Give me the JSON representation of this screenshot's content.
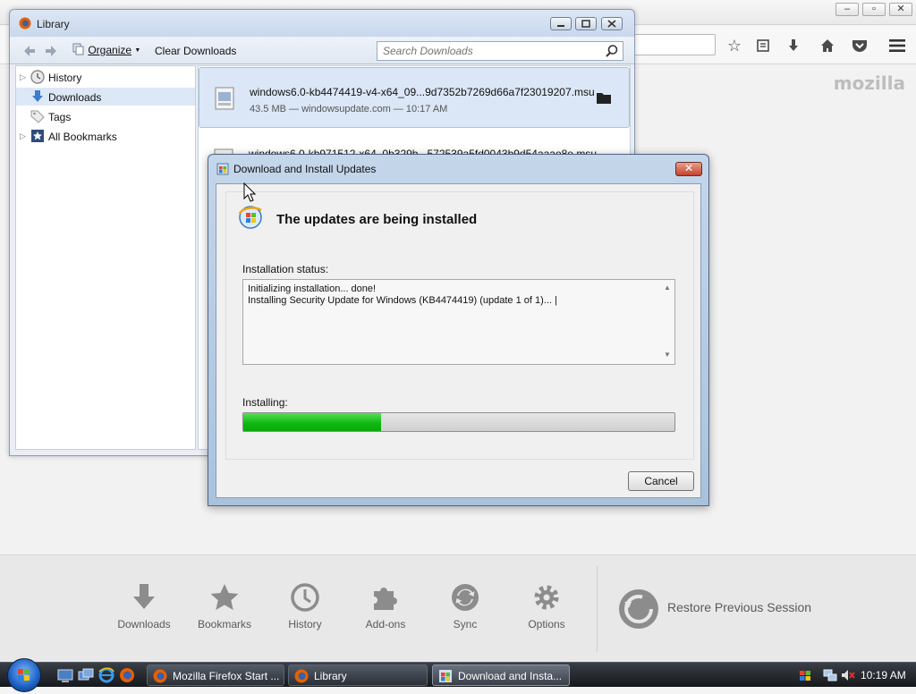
{
  "firefox": {
    "brand": "mozilla",
    "launcher": [
      {
        "label": "Downloads",
        "icon": "download-icon"
      },
      {
        "label": "Bookmarks",
        "icon": "star-icon"
      },
      {
        "label": "History",
        "icon": "clock-icon"
      },
      {
        "label": "Add-ons",
        "icon": "puzzle-icon"
      },
      {
        "label": "Sync",
        "icon": "sync-icon"
      },
      {
        "label": "Options",
        "icon": "gear-icon"
      }
    ],
    "restore_label": "Restore Previous Session"
  },
  "library": {
    "title": "Library",
    "toolbar": {
      "organize_label": "Organize",
      "clear_label": "Clear Downloads",
      "search_placeholder": "Search Downloads"
    },
    "sidebar": [
      {
        "label": "History",
        "icon": "clock-icon",
        "expandable": true
      },
      {
        "label": "Downloads",
        "icon": "download-icon",
        "selected": true
      },
      {
        "label": "Tags",
        "icon": "tag-icon"
      },
      {
        "label": "All Bookmarks",
        "icon": "bookmarks-icon",
        "expandable": true
      }
    ],
    "downloads": [
      {
        "name": "windows6.0-kb4474419-v4-x64_09...9d7352b7269d66a7f23019207.msu",
        "meta": "43.5 MB — windowsupdate.com — 10:17 AM"
      },
      {
        "name": "windows6.0-kb971512-x64_0b329b...572539a5fd0043b9d54aaae8e.msu",
        "meta": ""
      }
    ]
  },
  "dialog": {
    "title": "Download and Install Updates",
    "heading": "The updates are being installed",
    "status_label": "Installation status:",
    "status_text": "Initializing installation... done!\nInstalling Security Update for Windows (KB4474419) (update 1 of 1)... |",
    "installing_label": "Installing:",
    "progress_percent": 32,
    "cancel_label": "Cancel"
  },
  "taskbar": {
    "tasks": [
      {
        "label": "Mozilla Firefox Start ...",
        "active": false
      },
      {
        "label": "Library",
        "active": false
      },
      {
        "label": "Download and Insta...",
        "active": true
      }
    ],
    "clock": "10:19 AM"
  },
  "colors": {
    "progress_green": "#11b911",
    "accent_blue": "#1c5fc0"
  }
}
